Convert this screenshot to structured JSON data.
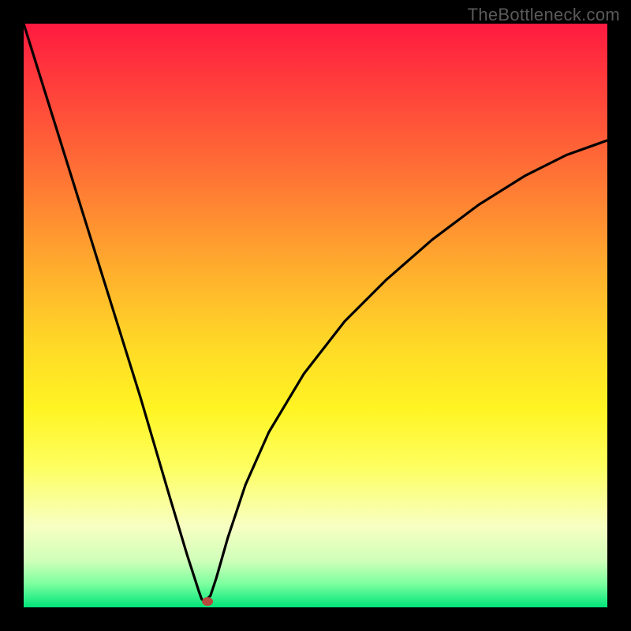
{
  "watermark": "TheBottleneck.com",
  "chart_data": {
    "type": "line",
    "title": "",
    "xlabel": "",
    "ylabel": "",
    "xlim": [
      0,
      1
    ],
    "ylim": [
      0,
      1
    ],
    "notes": "No axis ticks or labels are shown in the image; units unknown. Values below are read off normalized plot coordinates (x and y both 0–1, origin at bottom-left of the gradient area). A single black curve descends from the top-left corner to a sharp minimum near x≈0.31 (y≈0) then rises with decreasing slope toward the upper right, ending near y≈0.80 at x=1. A small red marker sits at the minimum.",
    "series": [
      {
        "name": "curve",
        "x": [
          0.0,
          0.05,
          0.1,
          0.15,
          0.2,
          0.25,
          0.28,
          0.3,
          0.305,
          0.31,
          0.32,
          0.33,
          0.35,
          0.38,
          0.42,
          0.48,
          0.55,
          0.62,
          0.7,
          0.78,
          0.86,
          0.93,
          1.0
        ],
        "y": [
          1.0,
          0.84,
          0.68,
          0.52,
          0.36,
          0.19,
          0.09,
          0.028,
          0.014,
          0.01,
          0.02,
          0.05,
          0.12,
          0.21,
          0.3,
          0.4,
          0.49,
          0.56,
          0.63,
          0.69,
          0.74,
          0.775,
          0.8
        ]
      }
    ],
    "marker": {
      "x": 0.315,
      "y": 0.01,
      "color": "#b64a3d"
    },
    "background_gradient": {
      "top": "#ff1a40",
      "mid": "#ffd927",
      "bottom": "#00e57a"
    },
    "frame_color": "#000000",
    "curve_color": "#000000"
  }
}
